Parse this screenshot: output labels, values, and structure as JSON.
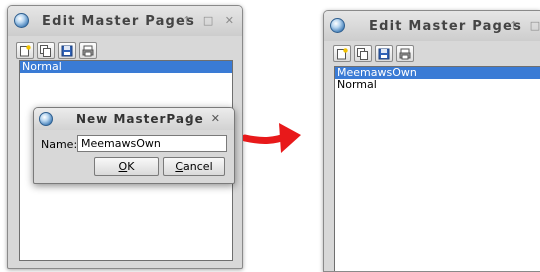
{
  "left_window": {
    "title": "Edit Master Pages",
    "controls": "↑ □ ✕",
    "list_items": [
      {
        "label": "Normal",
        "selected": true
      }
    ]
  },
  "dialog": {
    "title": "New MasterPage",
    "controls": "↑ ✕",
    "name_label": "Name:",
    "name_value": "MeemawsOwn",
    "ok_mnemonic": "O",
    "ok_rest": "K",
    "cancel_mnemonic": "C",
    "cancel_rest": "ancel"
  },
  "right_window": {
    "title": "Edit Master Pages",
    "controls": "↑ □ ✕",
    "list_items": [
      {
        "label": "MeemawsOwn",
        "selected": true
      },
      {
        "label": "Normal",
        "selected": false
      }
    ]
  },
  "toolbar_icons": [
    "new-page-icon",
    "duplicate-page-icon",
    "import-page-icon",
    "delete-page-icon"
  ],
  "colors": {
    "selection": "#3a7bd5",
    "arrow": "#e8191a",
    "window_bg": "#d8d8d8"
  }
}
